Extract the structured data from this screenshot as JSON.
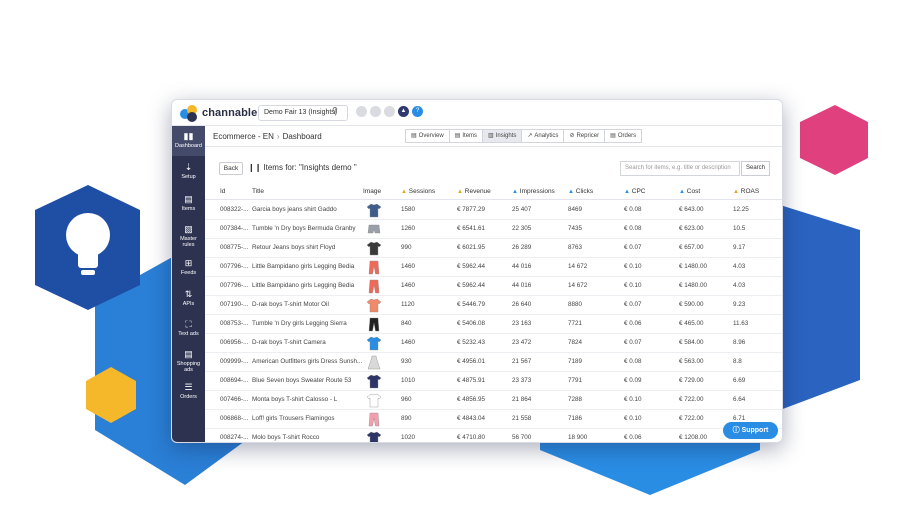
{
  "app": {
    "brand": "channable",
    "project": "Demo Fair 13 (Insights)"
  },
  "sidebar": {
    "items": [
      {
        "label": "Dashboard",
        "icon": "bar-chart-icon"
      },
      {
        "label": "Setup",
        "icon": "download-icon"
      },
      {
        "label": "Items",
        "icon": "cart-icon"
      },
      {
        "label": "Master rules",
        "icon": "clipboard-icon"
      },
      {
        "label": "Feeds",
        "icon": "sliders-icon"
      },
      {
        "label": "APIs",
        "icon": "arrows-icon"
      },
      {
        "label": "Text ads",
        "icon": "expand-icon"
      },
      {
        "label": "Shopping ads",
        "icon": "cart-icon"
      },
      {
        "label": "Orders",
        "icon": "list-icon"
      }
    ]
  },
  "breadcrumb": {
    "project": "Ecommerce - EN",
    "page": "Dashboard"
  },
  "tabs": [
    {
      "label": "Overview",
      "icon": "▤"
    },
    {
      "label": "Items",
      "icon": "🛒"
    },
    {
      "label": "Insights",
      "icon": "▥"
    },
    {
      "label": "Analytics",
      "icon": "↗"
    },
    {
      "label": "Repricer",
      "icon": "⊘"
    },
    {
      "label": "Orders",
      "icon": "▤"
    }
  ],
  "toolbar": {
    "back_label": "Back",
    "title": "Items for: \"Insights demo \"",
    "search_placeholder": "Search for items, e.g. title or description",
    "search_label": "Search"
  },
  "table": {
    "headers": [
      "Id",
      "Title",
      "Image",
      "Sessions",
      "Revenue",
      "Impressions",
      "Clicks",
      "CPC",
      "Cost",
      "ROAS"
    ],
    "rows": [
      {
        "id": "008322-...",
        "title": "Garcia boys jeans shirt Gaddo",
        "sessions": "1580",
        "revenue": "€ 7877.29",
        "impressions": "25 407",
        "clicks": "8469",
        "cpc": "€ 0.08",
        "cost": "€ 643.00",
        "roas": "12.25",
        "thumb": "#3f5d8a",
        "kind": "shirt"
      },
      {
        "id": "007384-...",
        "title": "Tumble 'n Dry boys Bermuda Granby",
        "sessions": "1260",
        "revenue": "€ 6541.61",
        "impressions": "22 305",
        "clicks": "7435",
        "cpc": "€ 0.08",
        "cost": "€ 623.00",
        "roas": "10.5",
        "thumb": "#9aa0aa",
        "kind": "shorts"
      },
      {
        "id": "008775-...",
        "title": "Retour Jeans boys shirt Floyd",
        "sessions": "990",
        "revenue": "€ 6021.95",
        "impressions": "26 289",
        "clicks": "8763",
        "cpc": "€ 0.07",
        "cost": "€ 657.00",
        "roas": "9.17",
        "thumb": "#3a3a3a",
        "kind": "shirt"
      },
      {
        "id": "007796-...",
        "title": "Little Bampidano girls Legging Bedia",
        "sessions": "1460",
        "revenue": "€ 5962.44",
        "impressions": "44 016",
        "clicks": "14 672",
        "cpc": "€ 0.10",
        "cost": "€ 1480.00",
        "roas": "4.03",
        "thumb": "#f06a5a",
        "kind": "pants"
      },
      {
        "id": "007796-...",
        "title": "Little Bampidano girls Legging Bedia",
        "sessions": "1460",
        "revenue": "€ 5962.44",
        "impressions": "44 016",
        "clicks": "14 672",
        "cpc": "€ 0.10",
        "cost": "€ 1480.00",
        "roas": "4.03",
        "thumb": "#f06a5a",
        "kind": "pants"
      },
      {
        "id": "007190-...",
        "title": "D-rak boys T-shirt Motor Oil",
        "sessions": "1120",
        "revenue": "€ 5446.79",
        "impressions": "26 640",
        "clicks": "8880",
        "cpc": "€ 0.07",
        "cost": "€ 590.00",
        "roas": "9.23",
        "thumb": "#f08a6a",
        "kind": "shirt"
      },
      {
        "id": "008753-...",
        "title": "Tumble 'n Dry girls Legging Sierra",
        "sessions": "840",
        "revenue": "€ 5406.08",
        "impressions": "23 163",
        "clicks": "7721",
        "cpc": "€ 0.06",
        "cost": "€ 465.00",
        "roas": "11.63",
        "thumb": "#222222",
        "kind": "pants"
      },
      {
        "id": "006956-...",
        "title": "D-rak boys T-shirt Camera",
        "sessions": "1460",
        "revenue": "€ 5232.43",
        "impressions": "23 472",
        "clicks": "7824",
        "cpc": "€ 0.07",
        "cost": "€ 584.00",
        "roas": "8.96",
        "thumb": "#2a8de4",
        "kind": "shirt"
      },
      {
        "id": "009999-...",
        "title": "American Outfitters girls Dress Sunsh...",
        "sessions": "930",
        "revenue": "€ 4956.01",
        "impressions": "21 567",
        "clicks": "7189",
        "cpc": "€ 0.08",
        "cost": "€ 563.00",
        "roas": "8.8",
        "thumb": "#d9d9d9",
        "kind": "dress"
      },
      {
        "id": "008694-...",
        "title": "Blue Seven boys Sweater Route 53",
        "sessions": "1010",
        "revenue": "€ 4875.91",
        "impressions": "23 373",
        "clicks": "7791",
        "cpc": "€ 0.09",
        "cost": "€ 729.00",
        "roas": "6.69",
        "thumb": "#2d3566",
        "kind": "shirt"
      },
      {
        "id": "007466-...",
        "title": "Monta boys T-shirt Calosso - L",
        "sessions": "960",
        "revenue": "€ 4856.95",
        "impressions": "21 864",
        "clicks": "7288",
        "cpc": "€ 0.10",
        "cost": "€ 722.00",
        "roas": "6.64",
        "thumb": "#ffffff",
        "kind": "shirt"
      },
      {
        "id": "006868-...",
        "title": "Loff! girls Trousers Flamingos",
        "sessions": "890",
        "revenue": "€ 4843.04",
        "impressions": "21 558",
        "clicks": "7186",
        "cpc": "€ 0.10",
        "cost": "€ 722.00",
        "roas": "6.71",
        "thumb": "#f2a0b0",
        "kind": "pants"
      },
      {
        "id": "008274-...",
        "title": "Molo boys T-shirt Rocco",
        "sessions": "1020",
        "revenue": "€ 4710.80",
        "impressions": "56 700",
        "clicks": "18 900",
        "cpc": "€ 0.06",
        "cost": "€ 1208.00",
        "roas": "",
        "thumb": "#2d3566",
        "kind": "shirt"
      }
    ]
  },
  "support": {
    "label": "Support",
    "icon": "help-icon"
  },
  "colors": {
    "sidebar": "#2d3250",
    "accent": "#2a8de4",
    "hexBlue": "#1e64b8",
    "hexPink": "#e0407e",
    "hexYellow": "#f5b82a"
  }
}
